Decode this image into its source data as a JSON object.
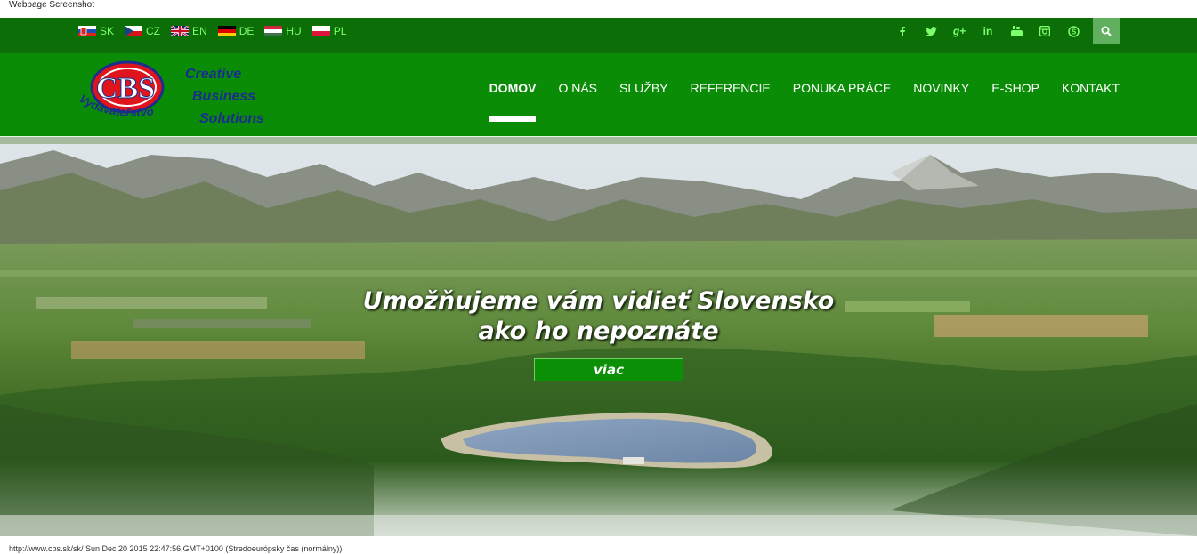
{
  "screenshot_title": "Webpage Screenshot",
  "languages": [
    {
      "code": "SK",
      "icon": "flag-sk-icon"
    },
    {
      "code": "CZ",
      "icon": "flag-cz-icon"
    },
    {
      "code": "EN",
      "icon": "flag-en-icon"
    },
    {
      "code": "DE",
      "icon": "flag-de-icon"
    },
    {
      "code": "HU",
      "icon": "flag-hu-icon"
    },
    {
      "code": "PL",
      "icon": "flag-pl-icon"
    }
  ],
  "social": [
    {
      "glyph": "f",
      "icon": "facebook-icon"
    },
    {
      "glyph": "t",
      "icon": "twitter-icon"
    },
    {
      "glyph": "g+",
      "icon": "google-plus-icon"
    },
    {
      "glyph": "in",
      "icon": "linkedin-icon"
    },
    {
      "glyph": "You",
      "icon": "youtube-icon"
    },
    {
      "glyph": "◙",
      "icon": "instagram-icon"
    },
    {
      "glyph": "S",
      "icon": "skype-icon"
    }
  ],
  "logo": {
    "badge": "CBS",
    "words": [
      "Creative",
      "Business",
      "Solutions"
    ],
    "arc_text": "Vydavateľstvo"
  },
  "nav": [
    {
      "label": "DOMOV",
      "active": true
    },
    {
      "label": "O NÁS"
    },
    {
      "label": "SLUŽBY"
    },
    {
      "label": "REFERENCIE"
    },
    {
      "label": "PONUKA PRÁCE"
    },
    {
      "label": "NOVINKY"
    },
    {
      "label": "E-SHOP"
    },
    {
      "label": "KONTAKT"
    }
  ],
  "hero": {
    "headline_line1": "Umožňujeme vám vidieť Slovensko",
    "headline_line2": "ako ho nepoznáte",
    "button": "viac"
  },
  "status_bar": "http://www.cbs.sk/sk/ Sun Dec 20 2015 22:47:56 GMT+0100 (Stredoeurópsky čas (normálny))",
  "colors": {
    "top_bar": "#0b6e06",
    "nav_bar": "#0a8c07",
    "accent_text": "#7dff6e",
    "logo_red": "#e0141c",
    "logo_blue": "#1b2e8c"
  }
}
